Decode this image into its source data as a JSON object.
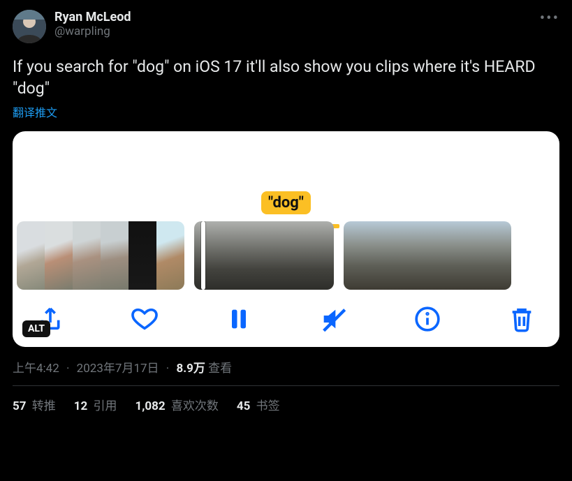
{
  "author": {
    "display_name": "Ryan McLeod",
    "handle": "@warpling"
  },
  "tweet_text": "If you search for \"dog\" on iOS 17 it'll also show you clips where it's HEARD \"dog\"",
  "translate_label": "翻译推文",
  "media": {
    "pill_label": "\"dog\"",
    "alt_badge": "ALT",
    "toolbar": {
      "share": "share",
      "like": "like",
      "pause": "pause",
      "mute": "mute",
      "info": "info",
      "delete": "delete"
    }
  },
  "meta": {
    "time": "上午4:42",
    "date": "2023年7月17日",
    "views_count": "8.9万",
    "views_label": "查看"
  },
  "stats": {
    "retweets": {
      "count": "57",
      "label": "转推"
    },
    "quotes": {
      "count": "12",
      "label": "引用"
    },
    "likes": {
      "count": "1,082",
      "label": "喜欢次数"
    },
    "bookmarks": {
      "count": "45",
      "label": "书签"
    }
  }
}
